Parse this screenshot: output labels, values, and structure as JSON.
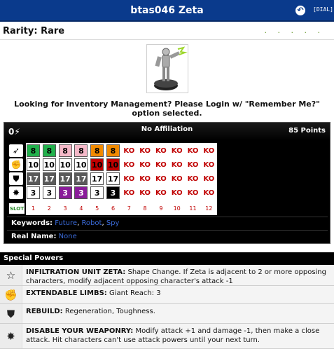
{
  "title": "btas046 Zeta",
  "header_buttons": {
    "dial_label": "[DIAL]"
  },
  "rarity_label": "Rarity: Rare",
  "rarity_dots": ". . . . .",
  "inventory_message": "Looking for Inventory Management? Please Login w/ \"Remember Me?\" option selected.",
  "dial": {
    "range": "0",
    "affiliation": "No Affiliation",
    "points": "85 Points",
    "slot_label": "SLOT",
    "slots": [
      "1",
      "2",
      "3",
      "4",
      "5",
      "6",
      "7",
      "8",
      "9",
      "10",
      "11",
      "12"
    ],
    "rows": [
      {
        "icon": "speed-icon",
        "cells": [
          "8",
          "8",
          "8",
          "8",
          "8",
          "8",
          "KO",
          "KO",
          "KO",
          "KO",
          "KO",
          "KO"
        ]
      },
      {
        "icon": "attack-icon",
        "cells": [
          "10",
          "10",
          "10",
          "10",
          "10",
          "10",
          "KO",
          "KO",
          "KO",
          "KO",
          "KO",
          "KO"
        ]
      },
      {
        "icon": "defense-icon",
        "cells": [
          "17",
          "17",
          "17",
          "17",
          "17",
          "17",
          "KO",
          "KO",
          "KO",
          "KO",
          "KO",
          "KO"
        ]
      },
      {
        "icon": "damage-icon",
        "cells": [
          "3",
          "3",
          "3",
          "3",
          "3",
          "3",
          "KO",
          "KO",
          "KO",
          "KO",
          "KO",
          "KO"
        ]
      }
    ],
    "colors": {
      "green": "#22b14c",
      "pink": "#f4b8c8",
      "orange": "#f08a00",
      "white": "#ffffff",
      "red": "#c00000",
      "gray": "#5a5a5a",
      "purple": "#8a1c9a",
      "black": "#000000"
    },
    "keywords_label": "Keywords:",
    "keywords": [
      "Future",
      "Robot",
      "Spy"
    ],
    "keywords_separator": ", ",
    "realname_label": "Real Name:",
    "realname_value": "None"
  },
  "special_powers_title": "Special Powers",
  "powers": [
    {
      "icon": "star-icon",
      "name": "INFILTRATION UNIT ZETA:",
      "text": " Shape Change. If Zeta is adjacent to 2 or more opposing characters, modify adjacent opposing character's attack -1"
    },
    {
      "icon": "fist-icon",
      "name": "EXTENDABLE LIMBS:",
      "text": " Giant Reach: 3"
    },
    {
      "icon": "shield-icon",
      "name": "REBUILD:",
      "text": " Regeneration, Toughness."
    },
    {
      "icon": "starburst-icon",
      "name": "DISABLE YOUR WEAPONRY:",
      "text": " Modify attack +1 and damage -1, then make a close attack. Hit characters can't use attack powers until your next turn."
    }
  ]
}
